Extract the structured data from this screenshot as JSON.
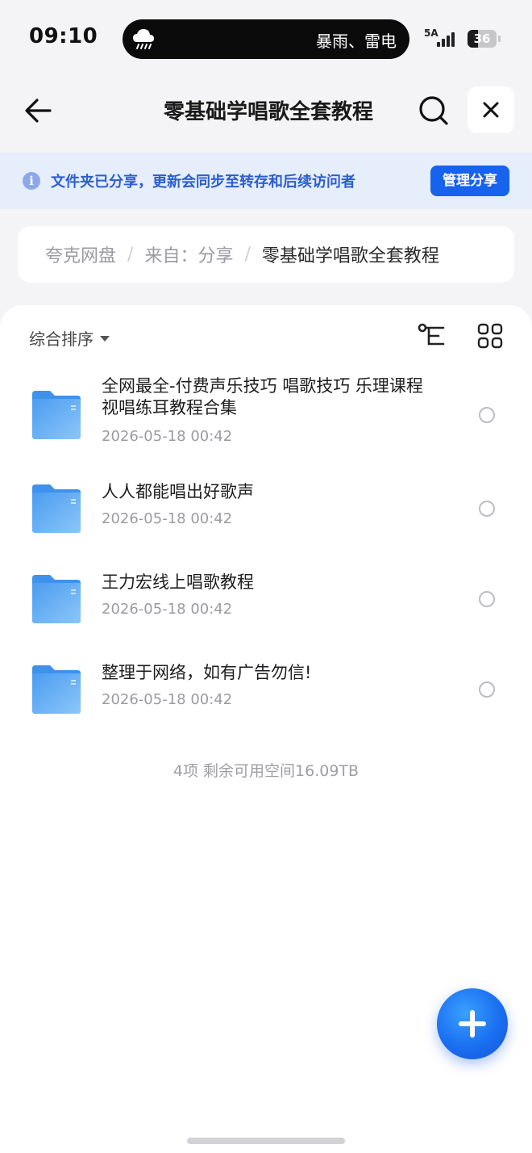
{
  "status_bar": {
    "time": "09:10",
    "weather_text": "暴雨、雷电",
    "network": "5A",
    "battery": "36",
    "battery_level": 0.36
  },
  "nav": {
    "title": "零基础学唱歌全套教程",
    "back_icon": "arrow-left-icon",
    "search_icon": "search-icon",
    "close_icon": "close-icon"
  },
  "banner": {
    "text": "文件夹已分享，更新会同步至转存和后续访问者",
    "button": "管理分享",
    "accent": "#1763ee"
  },
  "breadcrumb": {
    "root": "夸克网盘",
    "sep": "/",
    "from": "来自：分享",
    "current": "零基础学唱歌全套教程"
  },
  "toolbar": {
    "sort_label": "综合排序"
  },
  "files": [
    {
      "name": "全网最全-付费声乐技巧 唱歌技巧 乐理课程 视唱练耳教程合集",
      "date": "2026-05-18 00:42"
    },
    {
      "name": "人人都能唱出好歌声",
      "date": "2026-05-18 00:42"
    },
    {
      "name": "王力宏线上唱歌教程",
      "date": "2026-05-18 00:42"
    },
    {
      "name": "整理于网络，如有广告勿信!",
      "date": "2026-05-18 00:42"
    }
  ],
  "summary": "4项 剩余可用空间16.09TB",
  "colors": {
    "folder": "#5aa8f0",
    "banner_bg": "#e6eefb",
    "banner_text": "#2d5ecf"
  }
}
